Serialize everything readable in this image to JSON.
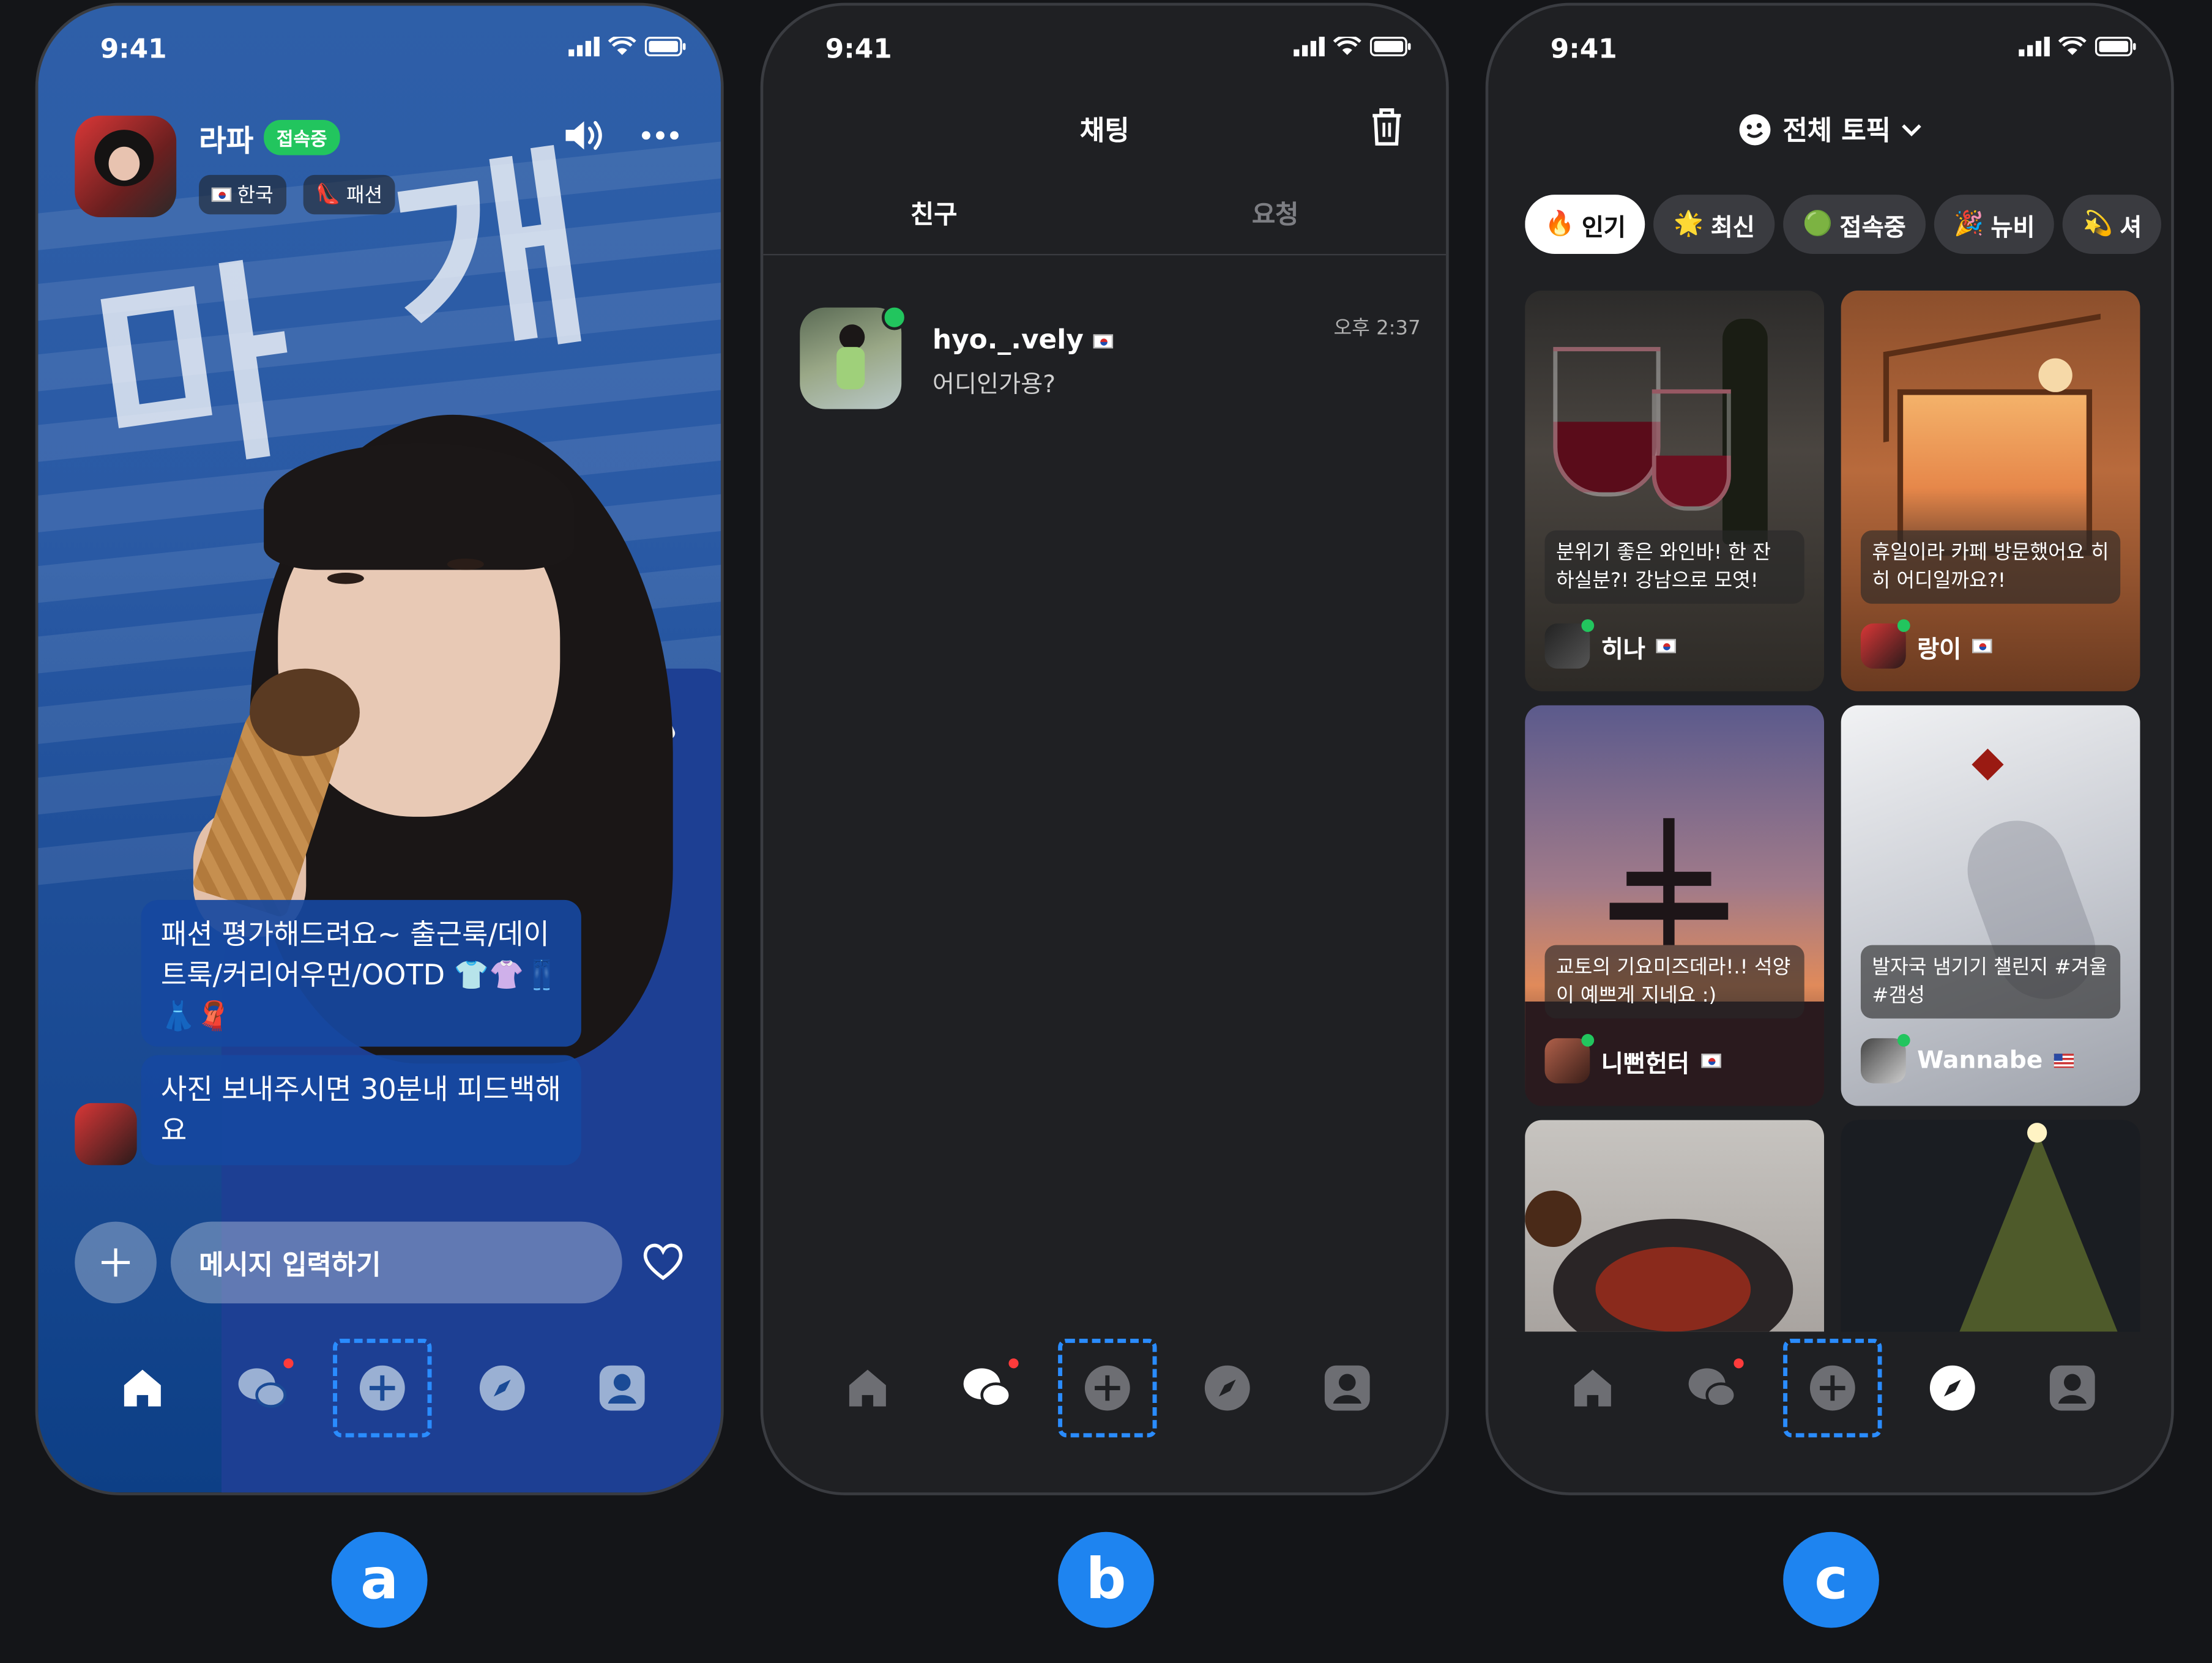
{
  "status": {
    "time": "9:41"
  },
  "screen_a": {
    "profile": {
      "name": "라파",
      "status_badge": "접속중",
      "chips": [
        "한국",
        "패션"
      ]
    },
    "bubbles": [
      "패션 평가해드려요~ 출근룩/데이트룩/커리어우먼/OOTD 👕👚👖👗🧣",
      "사진 보내주시면 30분내 피드백해요"
    ],
    "message_input": {
      "placeholder": "메시지 입력하기"
    }
  },
  "screen_b": {
    "title": "채팅",
    "tabs": [
      "친구",
      "요청"
    ],
    "chat": {
      "name": "hyo._.vely",
      "message": "어디인가용?",
      "time": "오후 2:37"
    }
  },
  "screen_c": {
    "title": "전체 토픽",
    "filters": [
      {
        "icon": "🔥",
        "label": "인기"
      },
      {
        "icon": "🌟",
        "label": "최신"
      },
      {
        "icon": "🟢",
        "label": "접속중"
      },
      {
        "icon": "🎉",
        "label": "뉴비"
      },
      {
        "icon": "💫",
        "label": "셔"
      }
    ],
    "cards": [
      {
        "caption": "분위기 좋은 와인바! 한 잔 하실분?! 강남으로 모엿!",
        "user": "히나",
        "flag": "kr"
      },
      {
        "caption": "휴일이라 카페 방문했어요 히히 어디일까요?!",
        "user": "랑이",
        "flag": "kr"
      },
      {
        "caption": "교토의 기요미즈데라!.! 석양이 예쁘게 지네요 :)",
        "user": "니뻔헌터",
        "flag": "kr"
      },
      {
        "caption": "발자국 냄기기 챌린지 #겨울 #갬성",
        "user": "Wannabe",
        "flag": "us"
      }
    ]
  },
  "labels": [
    "a",
    "b",
    "c"
  ],
  "colors": {
    "accent": "#1e84f0",
    "online": "#22c55e",
    "notification": "#ff3b3b"
  }
}
